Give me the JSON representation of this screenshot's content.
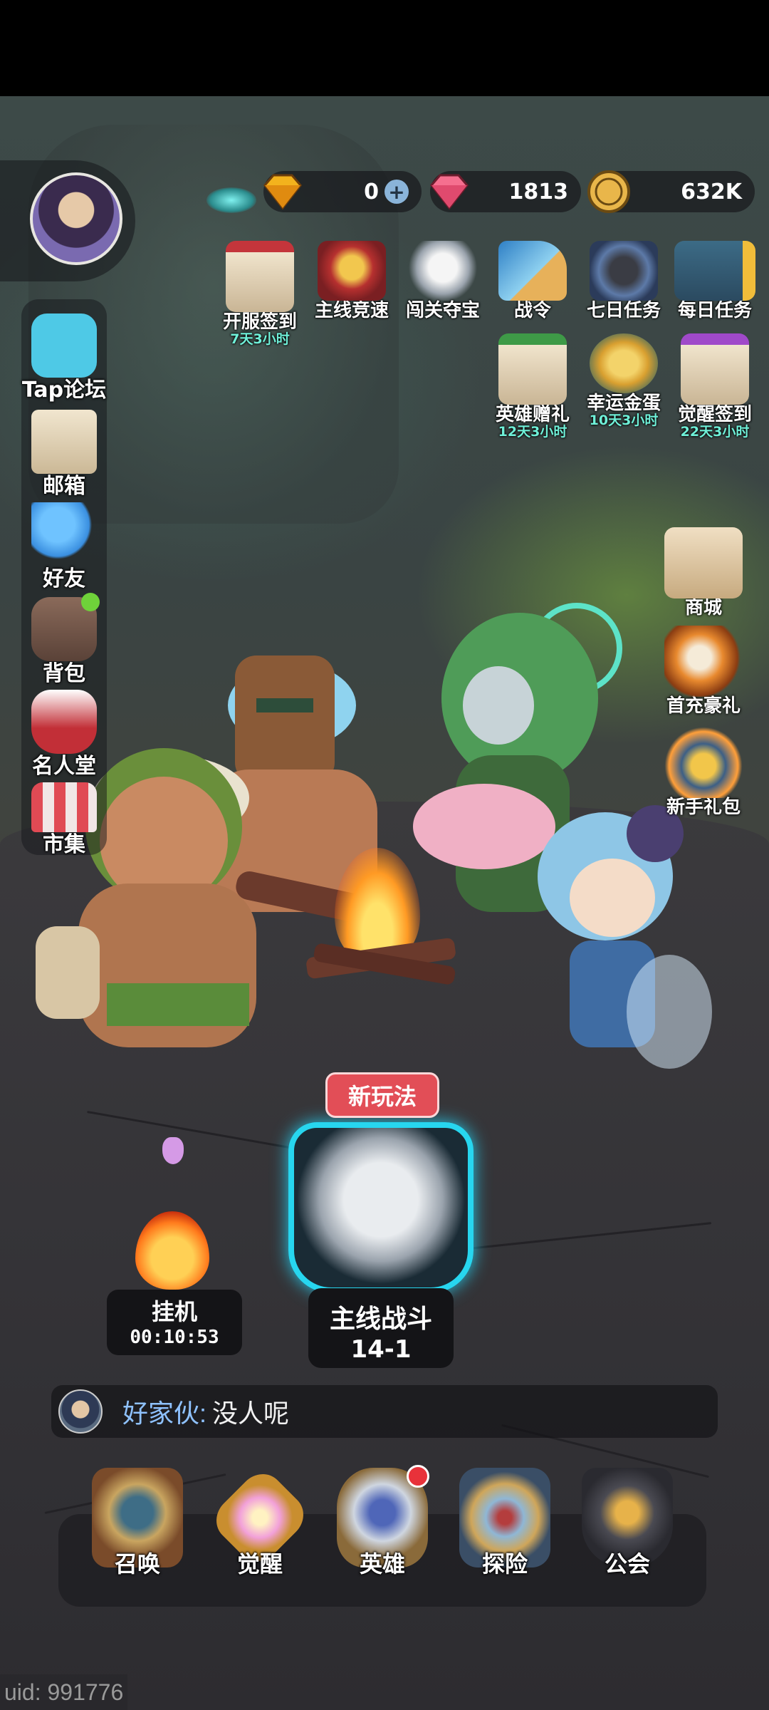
{
  "currencies": {
    "gold_gem": {
      "value": "0",
      "icon": "yellow-diamond-icon"
    },
    "pink_gem": {
      "value": "1813",
      "icon": "pink-diamond-icon"
    },
    "coin": {
      "value": "632K",
      "icon": "gold-coin-icon"
    }
  },
  "events_row1": [
    {
      "label": "开服签到",
      "timer": "7天3小时"
    },
    {
      "label": "主线竞速",
      "timer": ""
    },
    {
      "label": "闯关夺宝",
      "timer": ""
    },
    {
      "label": "战令",
      "timer": ""
    },
    {
      "label": "七日任务",
      "timer": ""
    },
    {
      "label": "每日任务",
      "timer": ""
    }
  ],
  "events_row2": [
    {
      "label": "英雄赠礼",
      "timer": "12天3小时"
    },
    {
      "label": "幸运金蛋",
      "timer": "10天3小时"
    },
    {
      "label": "觉醒签到",
      "timer": "22天3小时"
    }
  ],
  "sidebar": [
    {
      "label": "Tap论坛"
    },
    {
      "label": "邮箱"
    },
    {
      "label": "好友"
    },
    {
      "label": "背包"
    },
    {
      "label": "名人堂"
    },
    {
      "label": "市集"
    }
  ],
  "right_side": [
    {
      "label": "商城"
    },
    {
      "label": "首充豪礼"
    },
    {
      "label": "新手礼包"
    }
  ],
  "idle": {
    "title": "挂机",
    "time": "00:10:53"
  },
  "battle": {
    "badge": "新玩法",
    "title": "主线战斗",
    "stage": "14-1"
  },
  "chat": {
    "name": "好家伙:",
    "message": "没人呢"
  },
  "bottom_nav": [
    {
      "label": "召唤"
    },
    {
      "label": "觉醒"
    },
    {
      "label": "英雄"
    },
    {
      "label": "探险"
    },
    {
      "label": "公会"
    }
  ],
  "uid": "uid: 991776",
  "colors": {
    "timer": "#6ff0d8",
    "chat_name": "#8fc2ff",
    "new_badge": "#e24e57",
    "battle_glow": "#27d6ef",
    "notify_red": "#e8323a",
    "notify_green": "#6fd23a"
  }
}
